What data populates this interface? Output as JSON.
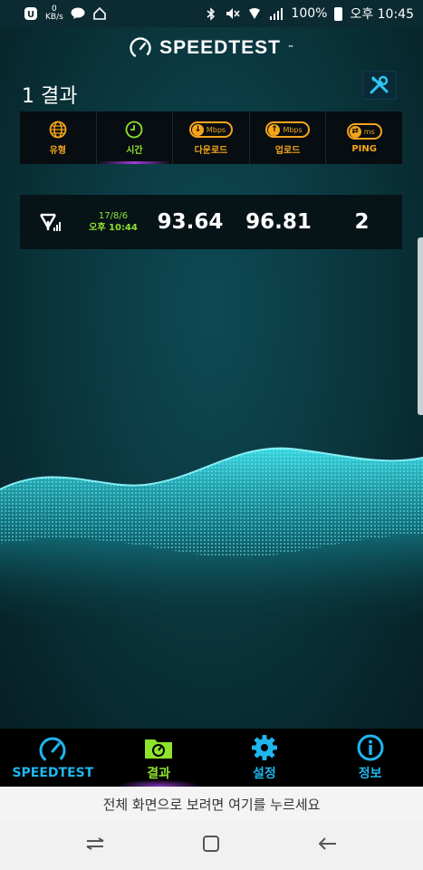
{
  "status_bar": {
    "kb_value": "0",
    "kb_unit": "KB/s",
    "battery": "100%",
    "time": "오후 10:45"
  },
  "app": {
    "brand": "SPEEDTEST",
    "brand_tm": "™",
    "results_title": "1 결과",
    "columns": [
      {
        "label": "유형",
        "icon": "globe-icon"
      },
      {
        "label": "시간",
        "icon": "clock-icon",
        "active": true
      },
      {
        "label": "다운로드",
        "unit": "Mbps",
        "icon": "download-arrow-icon"
      },
      {
        "label": "업로드",
        "unit": "Mbps",
        "icon": "upload-arrow-icon"
      },
      {
        "label": "PING",
        "unit": "ms",
        "icon": "ping-icon"
      }
    ],
    "results": [
      {
        "type_icon": "wifi-signal-icon",
        "date": "17/8/6",
        "time": "오후 10:44",
        "download": "93.64",
        "upload": "96.81",
        "ping": "2"
      }
    ]
  },
  "bottom_nav": [
    {
      "label": "SPEEDTEST",
      "icon": "speedometer-icon"
    },
    {
      "label": "결과",
      "icon": "results-folder-icon",
      "active": true
    },
    {
      "label": "설정",
      "icon": "gear-icon"
    },
    {
      "label": "정보",
      "icon": "info-icon"
    }
  ],
  "banner": "전체 화면으로 보려면 여기를 누르세요",
  "colors": {
    "accent_orange": "#f4a51c",
    "accent_green": "#8fe22d",
    "accent_blue": "#1fb6ee"
  }
}
